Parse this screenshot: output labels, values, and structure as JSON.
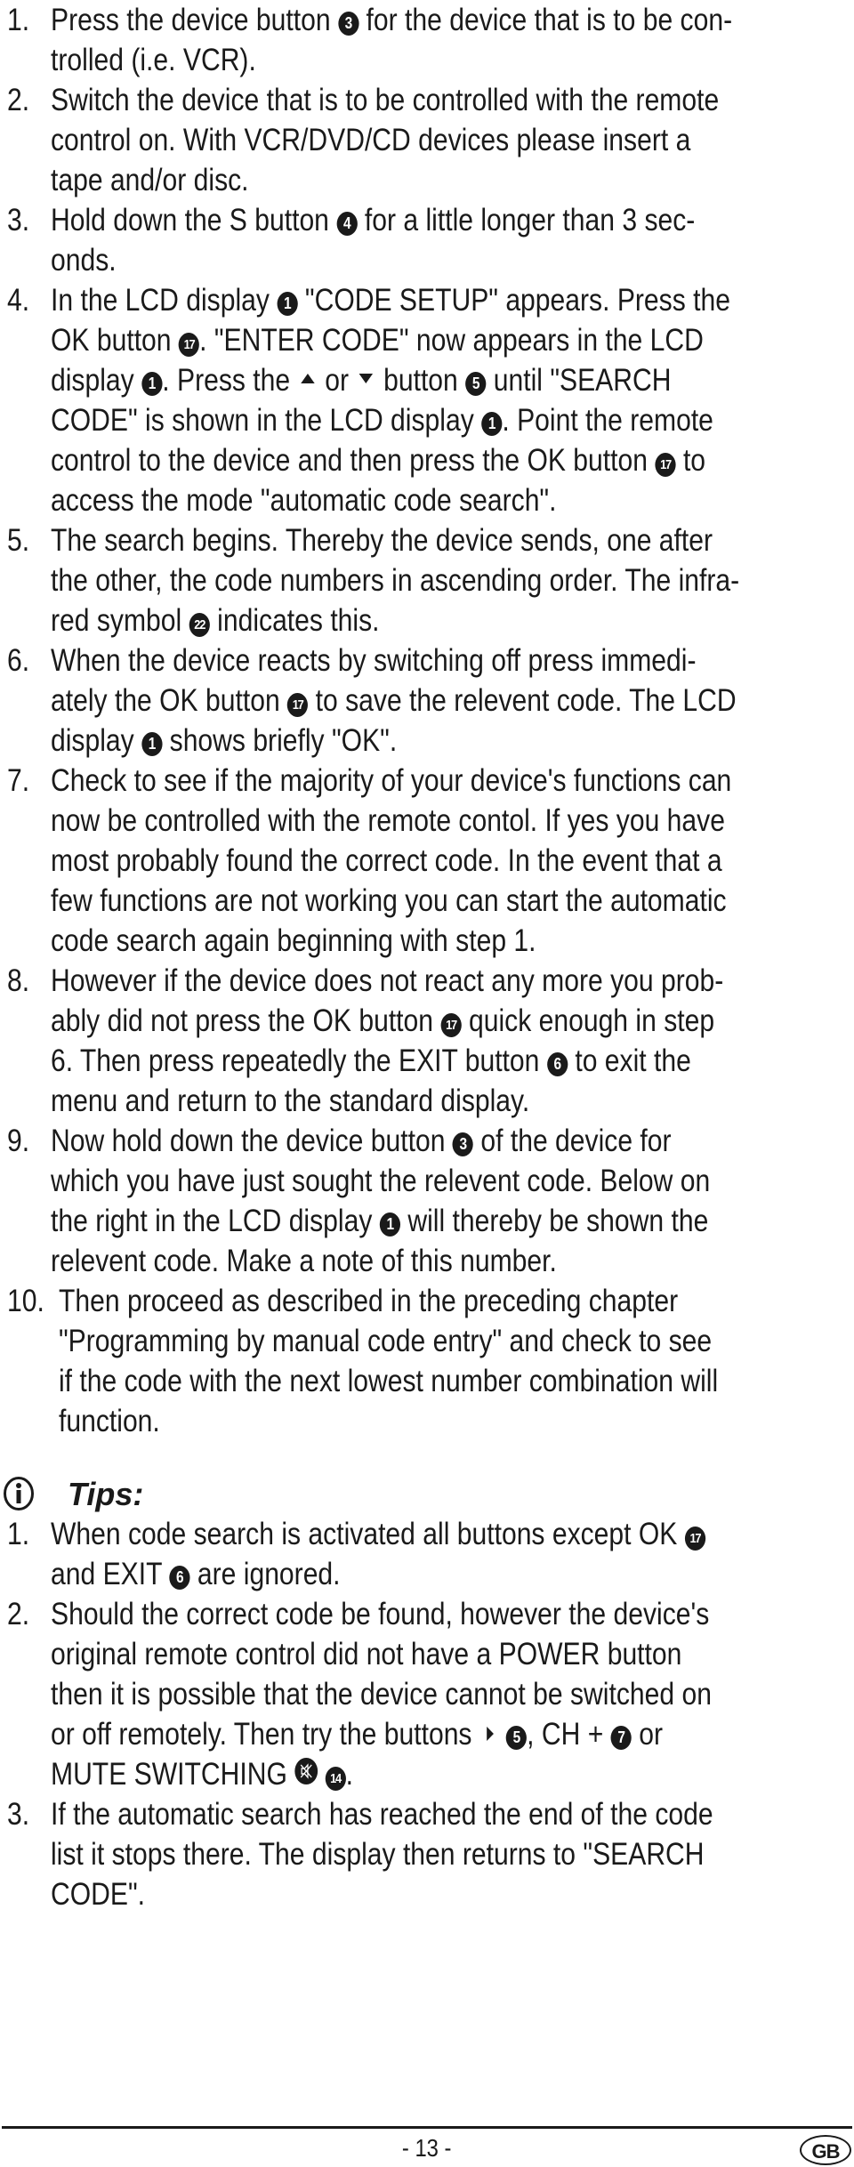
{
  "steps": [
    {
      "number": "1.",
      "lines": [
        [
          {
            "t": "Press the device button "
          },
          {
            "b": "3"
          },
          {
            "t": " for the device that is to be con-"
          }
        ],
        [
          {
            "t": "trolled (i.e. VCR)."
          }
        ]
      ]
    },
    {
      "number": "2.",
      "lines": [
        [
          {
            "t": "Switch the device that is to be controlled with the remote"
          }
        ],
        [
          {
            "t": "control on. With VCR/DVD/CD devices please insert a"
          }
        ],
        [
          {
            "t": "tape and/or disc."
          }
        ]
      ]
    },
    {
      "number": "3.",
      "lines": [
        [
          {
            "t": "Hold down the S button "
          },
          {
            "b": "4"
          },
          {
            "t": " for a little longer than 3 sec-"
          }
        ],
        [
          {
            "t": "onds."
          }
        ]
      ]
    },
    {
      "number": "4.",
      "lines": [
        [
          {
            "t": "In the LCD display "
          },
          {
            "b": "1"
          },
          {
            "t": " \"CODE SETUP\" appears. Press the"
          }
        ],
        [
          {
            "t": "OK button "
          },
          {
            "b": "17"
          },
          {
            "t": ". \"ENTER CODE\" now appears in the LCD"
          }
        ],
        [
          {
            "t": "display "
          },
          {
            "b": "1"
          },
          {
            "t": ". Press the "
          },
          {
            "a": "up"
          },
          {
            "t": " or "
          },
          {
            "a": "down"
          },
          {
            "t": " button "
          },
          {
            "b": "5"
          },
          {
            "t": " until \"SEARCH"
          }
        ],
        [
          {
            "t": "CODE\" is shown in the LCD display "
          },
          {
            "b": "1"
          },
          {
            "t": ". Point the remote"
          }
        ],
        [
          {
            "t": "control to the device and then press the OK button "
          },
          {
            "b": "17"
          },
          {
            "t": " to"
          }
        ],
        [
          {
            "t": "access the mode \"automatic code search\"."
          }
        ]
      ]
    },
    {
      "number": "5.",
      "lines": [
        [
          {
            "t": "The search begins. Thereby the device sends, one after"
          }
        ],
        [
          {
            "t": "the other, the code numbers in ascending order. The infra-"
          }
        ],
        [
          {
            "t": "red symbol "
          },
          {
            "b": "22"
          },
          {
            "t": " indicates this."
          }
        ]
      ]
    },
    {
      "number": "6.",
      "lines": [
        [
          {
            "t": "When the device reacts by switching off press immedi-"
          }
        ],
        [
          {
            "t": "ately the OK button "
          },
          {
            "b": "17"
          },
          {
            "t": " to save the relevent code. The LCD"
          }
        ],
        [
          {
            "t": "display "
          },
          {
            "b": "1"
          },
          {
            "t": " shows briefly \"OK\"."
          }
        ]
      ]
    },
    {
      "number": "7.",
      "lines": [
        [
          {
            "t": "Check to see if the majority of your device's functions can"
          }
        ],
        [
          {
            "t": "now be controlled with the remote contol. If yes you have"
          }
        ],
        [
          {
            "t": "most probably found the correct code. In the event that a"
          }
        ],
        [
          {
            "t": "few functions are not working you can start the automatic"
          }
        ],
        [
          {
            "t": "code search again beginning with step 1."
          }
        ]
      ]
    },
    {
      "number": "8.",
      "lines": [
        [
          {
            "t": "However if the device does not react any more you prob-"
          }
        ],
        [
          {
            "t": "ably did not press the OK button "
          },
          {
            "b": "17"
          },
          {
            "t": " quick enough in step"
          }
        ],
        [
          {
            "t": "6. Then press repeatedly the EXIT button "
          },
          {
            "b": "6"
          },
          {
            "t": " to exit the"
          }
        ],
        [
          {
            "t": "menu and return to the standard display."
          }
        ]
      ]
    },
    {
      "number": "9.",
      "lines": [
        [
          {
            "t": "Now hold down the device button "
          },
          {
            "b": "3"
          },
          {
            "t": " of the device for"
          }
        ],
        [
          {
            "t": "which you have just sought the relevent code. Below on"
          }
        ],
        [
          {
            "t": "the right in the LCD display "
          },
          {
            "b": "1"
          },
          {
            "t": " will thereby be shown the"
          }
        ],
        [
          {
            "t": "relevent code. Make a note of this number."
          }
        ]
      ]
    },
    {
      "number": "10.",
      "indent": true,
      "lines": [
        [
          {
            "t": "Then proceed as described in the preceding chapter"
          }
        ],
        [
          {
            "t": "\"Programming by manual code entry\" and check to see"
          }
        ],
        [
          {
            "t": "if the code with the next lowest number combination will"
          }
        ],
        [
          {
            "t": "function."
          }
        ]
      ]
    }
  ],
  "tips": {
    "icon": "info-icon",
    "title": "Tips:",
    "items": [
      {
        "number": "1.",
        "lines": [
          [
            {
              "t": "When code search is activated all buttons except OK "
            },
            {
              "b": "17"
            }
          ],
          [
            {
              "t": "and EXIT "
            },
            {
              "b": "6"
            },
            {
              "t": " are ignored."
            }
          ]
        ]
      },
      {
        "number": "2.",
        "lines": [
          [
            {
              "t": "Should the correct code be found, however the device's"
            }
          ],
          [
            {
              "t": "original remote control did not have a POWER button"
            }
          ],
          [
            {
              "t": "then it is possible that the device cannot be switched on"
            }
          ],
          [
            {
              "t": "or off remotely. Then try the buttons "
            },
            {
              "a": "right"
            },
            {
              "b": "5"
            },
            {
              "t": ", CH + "
            },
            {
              "b": "7"
            },
            {
              "t": " or"
            }
          ],
          [
            {
              "t": "MUTE SWITCHING "
            },
            {
              "m": "mute"
            },
            {
              "t": " "
            },
            {
              "b": "14"
            },
            {
              "t": "."
            }
          ]
        ]
      },
      {
        "number": "3.",
        "lines": [
          [
            {
              "t": "If the automatic search has reached the end of the code"
            }
          ],
          [
            {
              "t": "list it stops there. The display then returns to \"SEARCH"
            }
          ],
          [
            {
              "t": "CODE\"."
            }
          ]
        ]
      }
    ]
  },
  "footer": {
    "page_number": "- 13 -",
    "country_badge": "GB"
  },
  "colors": {
    "text": "#1a1a1a",
    "background": "#ffffff"
  }
}
